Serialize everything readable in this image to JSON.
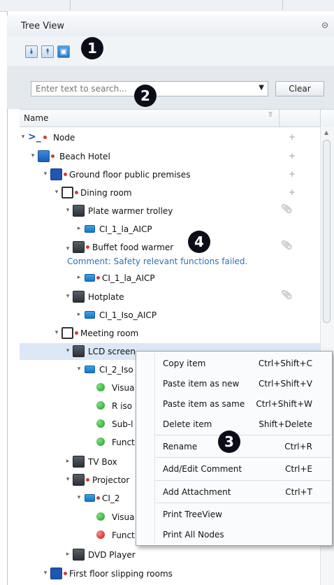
{
  "panel": {
    "title": "Tree View",
    "pin_icon": "pin-icon"
  },
  "toolbar": {
    "buttons": [
      {
        "icon": "expand-all-icon"
      },
      {
        "icon": "collapse-all-icon"
      },
      {
        "icon": "locate-icon"
      }
    ]
  },
  "badges": [
    "1",
    "2",
    "3",
    "4"
  ],
  "search": {
    "placeholder": "Enter text to search...",
    "value": "",
    "clear_label": "Clear"
  },
  "columns": {
    "name": "Name"
  },
  "tree": {
    "node": "Node",
    "beach_hotel": "Beach Hotel",
    "ground_floor": "Ground floor public premises",
    "dining_room": "Dining room",
    "plate_warmer": "Plate warmer trolley",
    "ci_1_la_1": "CI_1_la_AICP",
    "buffet": "Buffet food warmer",
    "comment": "Comment: Safety relevant functions failed.",
    "ci_1_la_2": "CI_1_la_AICP",
    "hotplate": "Hotplate",
    "ci_1_iso": "CI_1_Iso_AICP",
    "meeting_room": "Meeting room",
    "lcd_screen": "LCD screen",
    "ci_2_iso": "CI_2_Iso",
    "visual_1": "Visua",
    "r_iso": "R iso",
    "sub": "Sub-l",
    "funct_1": "Funct",
    "tv_box": "TV Box",
    "projector": "Projector",
    "ci_2": "CI_2",
    "visual_2": "Visua",
    "funct_2": "Funct",
    "dvd": "DVD Player",
    "first_floor": "First floor slipping rooms"
  },
  "context_menu": [
    {
      "label": "Copy item",
      "shortcut": "Ctrl+Shift+C"
    },
    {
      "label": "Paste item as new",
      "shortcut": "Ctrl+Shift+V"
    },
    {
      "label": "Paste item as same",
      "shortcut": "Ctrl+Shift+W"
    },
    {
      "label": "Delete item",
      "shortcut": "Shift+Delete"
    },
    {
      "label": "Rename",
      "shortcut": "Ctrl+R"
    },
    {
      "label": "Add/Edit Comment",
      "shortcut": "Ctrl+E"
    },
    {
      "label": "Add Attachment",
      "shortcut": "Ctrl+T"
    },
    {
      "label": "Print TreeView",
      "shortcut": ""
    },
    {
      "label": "Print All Nodes",
      "shortcut": ""
    }
  ],
  "colors": {
    "accent": "#1f78c8",
    "comment": "#2f6fb2",
    "status_ok": "#2fb82f",
    "status_fail": "#d82020",
    "selection": "#dce8f6"
  }
}
